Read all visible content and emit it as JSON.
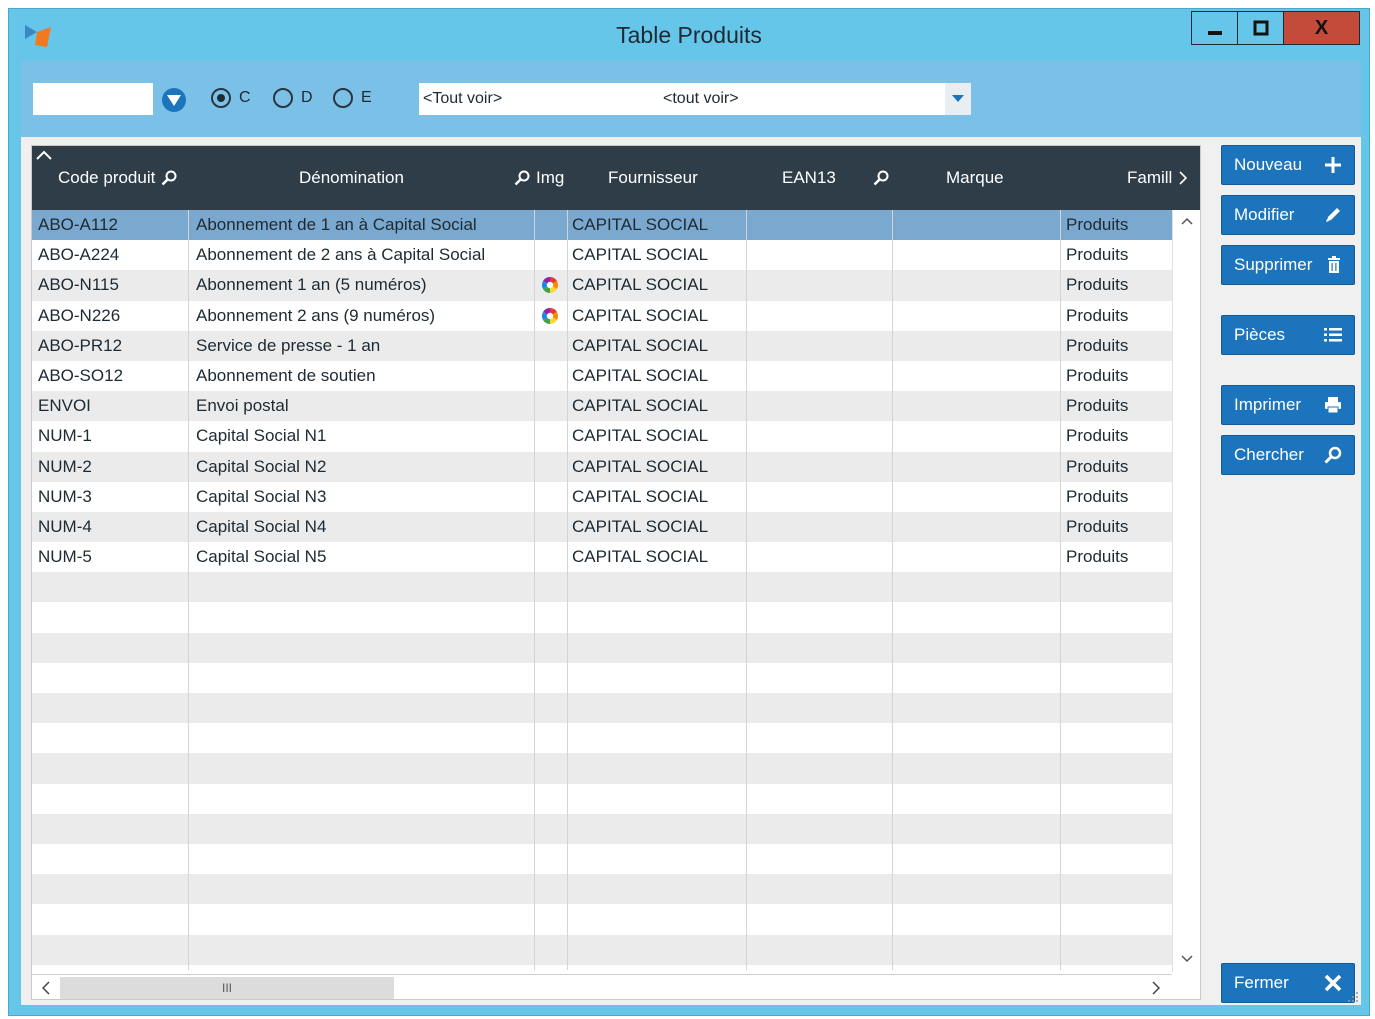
{
  "window": {
    "title": "Table Produits",
    "min_glyph": "▬",
    "max_glyph": "◻",
    "close_glyph": "X"
  },
  "toolbar": {
    "search_value": "",
    "radios": [
      {
        "label": "C",
        "checked": true
      },
      {
        "label": "D",
        "checked": false
      },
      {
        "label": "E",
        "checked": false
      }
    ],
    "combo_value": "<Tout voir>",
    "combo_value2": "<tout voir>"
  },
  "table": {
    "columns": [
      "Code produit",
      "Dénomination",
      "Img",
      "Fournisseur",
      "EAN13",
      "Marque",
      "Famill"
    ],
    "rows": [
      {
        "code": "ABO-A112",
        "denom": "Abonnement de 1 an à Capital Social",
        "img": false,
        "fourn": "CAPITAL SOCIAL",
        "ean": "",
        "marque": "",
        "famille": "Produits",
        "selected": true
      },
      {
        "code": "ABO-A224",
        "denom": "Abonnement de 2 ans à Capital Social",
        "img": false,
        "fourn": "CAPITAL SOCIAL",
        "ean": "",
        "marque": "",
        "famille": "Produits",
        "selected": false
      },
      {
        "code": "ABO-N115",
        "denom": "Abonnement 1 an (5 numéros)",
        "img": true,
        "fourn": "CAPITAL SOCIAL",
        "ean": "",
        "marque": "",
        "famille": "Produits",
        "selected": false
      },
      {
        "code": "ABO-N226",
        "denom": "Abonnement 2 ans (9 numéros)",
        "img": true,
        "fourn": "CAPITAL SOCIAL",
        "ean": "",
        "marque": "",
        "famille": "Produits",
        "selected": false
      },
      {
        "code": "ABO-PR12",
        "denom": "Service de presse - 1 an",
        "img": false,
        "fourn": "CAPITAL SOCIAL",
        "ean": "",
        "marque": "",
        "famille": "Produits",
        "selected": false
      },
      {
        "code": "ABO-SO12",
        "denom": "Abonnement de soutien",
        "img": false,
        "fourn": "CAPITAL SOCIAL",
        "ean": "",
        "marque": "",
        "famille": "Produits",
        "selected": false
      },
      {
        "code": "ENVOI",
        "denom": "Envoi postal",
        "img": false,
        "fourn": "CAPITAL SOCIAL",
        "ean": "",
        "marque": "",
        "famille": "Produits",
        "selected": false
      },
      {
        "code": "NUM-1",
        "denom": "Capital Social N1",
        "img": false,
        "fourn": "CAPITAL SOCIAL",
        "ean": "",
        "marque": "",
        "famille": "Produits",
        "selected": false
      },
      {
        "code": "NUM-2",
        "denom": "Capital Social N2",
        "img": false,
        "fourn": "CAPITAL SOCIAL",
        "ean": "",
        "marque": "",
        "famille": "Produits",
        "selected": false
      },
      {
        "code": "NUM-3",
        "denom": "Capital Social N3",
        "img": false,
        "fourn": "CAPITAL SOCIAL",
        "ean": "",
        "marque": "",
        "famille": "Produits",
        "selected": false
      },
      {
        "code": "NUM-4",
        "denom": "Capital Social N4",
        "img": false,
        "fourn": "CAPITAL SOCIAL",
        "ean": "",
        "marque": "",
        "famille": "Produits",
        "selected": false
      },
      {
        "code": "NUM-5",
        "denom": "Capital Social N5",
        "img": false,
        "fourn": "CAPITAL SOCIAL",
        "ean": "",
        "marque": "",
        "famille": "Produits",
        "selected": false
      }
    ],
    "empty_rows": 13,
    "hscroll_thumb": "III"
  },
  "buttons": {
    "nouveau": "Nouveau",
    "modifier": "Modifier",
    "supprimer": "Supprimer",
    "pieces": "Pièces",
    "imprimer": "Imprimer",
    "chercher": "Chercher",
    "fermer": "Fermer"
  },
  "colors": {
    "title_bar": "#66c6ea",
    "toolbar": "#7bc0e6",
    "header": "#2e3d47",
    "button": "#1c74bd",
    "selected_row": "#7ba8cf",
    "close_button": "#c44b3a"
  }
}
